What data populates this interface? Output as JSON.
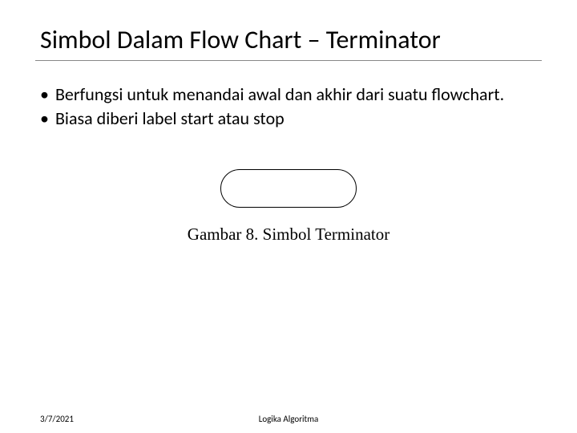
{
  "title": "Simbol Dalam Flow Chart – Terminator",
  "bullets": [
    "Berfungsi untuk menandai awal dan akhir dari suatu flowchart.",
    "Biasa diberi label start atau stop"
  ],
  "figure": {
    "caption": "Gambar 8. Simbol Terminator"
  },
  "footer": {
    "date": "3/7/2021",
    "center": "Logika Algoritma"
  }
}
